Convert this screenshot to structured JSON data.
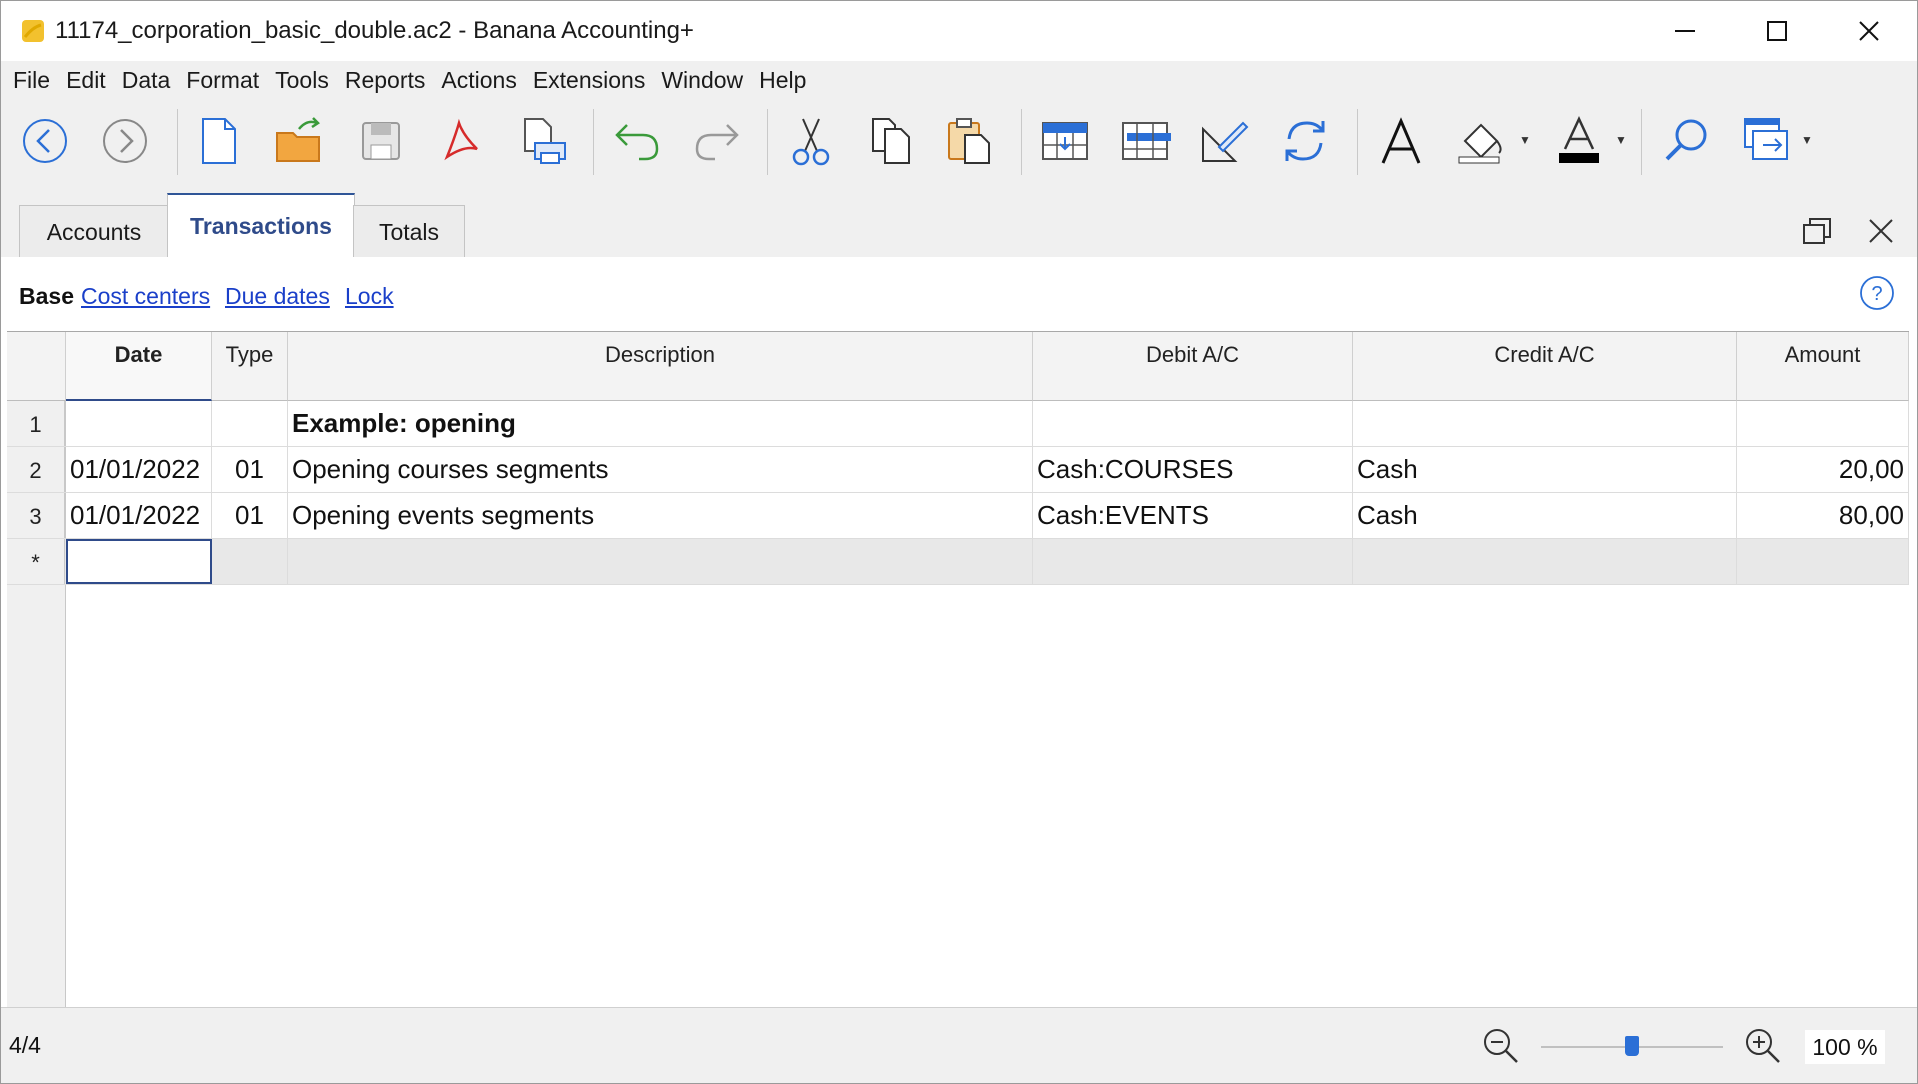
{
  "window": {
    "title": "11174_corporation_basic_double.ac2 - Banana Accounting+",
    "controls": {
      "minimize": "minimize-icon",
      "maximize": "maximize-icon",
      "close": "close-icon"
    }
  },
  "menu": [
    "File",
    "Edit",
    "Data",
    "Format",
    "Tools",
    "Reports",
    "Actions",
    "Extensions",
    "Window",
    "Help"
  ],
  "toolbar": {
    "buttons": [
      "back-icon",
      "forward-icon",
      "new-file-icon",
      "open-file-icon",
      "save-icon",
      "pdf-icon",
      "print-preview-icon",
      "undo-icon",
      "redo-icon",
      "cut-icon",
      "copy-icon",
      "paste-icon",
      "insert-row-icon",
      "delete-row-icon",
      "edit-icon",
      "recalculate-icon",
      "font-icon",
      "fill-color-icon",
      "text-color-icon",
      "find-icon",
      "window-icon"
    ]
  },
  "tabs": [
    "Accounts",
    "Transactions",
    "Totals"
  ],
  "active_tab": "Transactions",
  "views": {
    "base": "Base",
    "links": [
      "Cost centers",
      "Due dates",
      "Lock"
    ]
  },
  "table": {
    "columns": [
      "Date",
      "Type",
      "Description",
      "Debit A/C",
      "Credit A/C",
      "Amount"
    ],
    "rows": [
      {
        "num": "1",
        "date": "",
        "type": "",
        "description": "Example: opening",
        "debit": "",
        "credit": "",
        "amount": ""
      },
      {
        "num": "2",
        "date": "01/01/2022",
        "type": "01",
        "description": "Opening courses segments",
        "debit": "Cash:COURSES",
        "credit": "Cash",
        "amount": "20,00"
      },
      {
        "num": "3",
        "date": "01/01/2022",
        "type": "01",
        "description": "Opening events segments",
        "debit": "Cash:EVENTS",
        "credit": "Cash",
        "amount": "80,00"
      }
    ],
    "new_row_marker": "*"
  },
  "status": {
    "position": "4/4",
    "zoom": "100 %",
    "zoom_level": 0.5
  },
  "colors": {
    "accent": "#2f4b8a",
    "link": "#1a3fc9",
    "chrome": "#f0f0f0"
  }
}
